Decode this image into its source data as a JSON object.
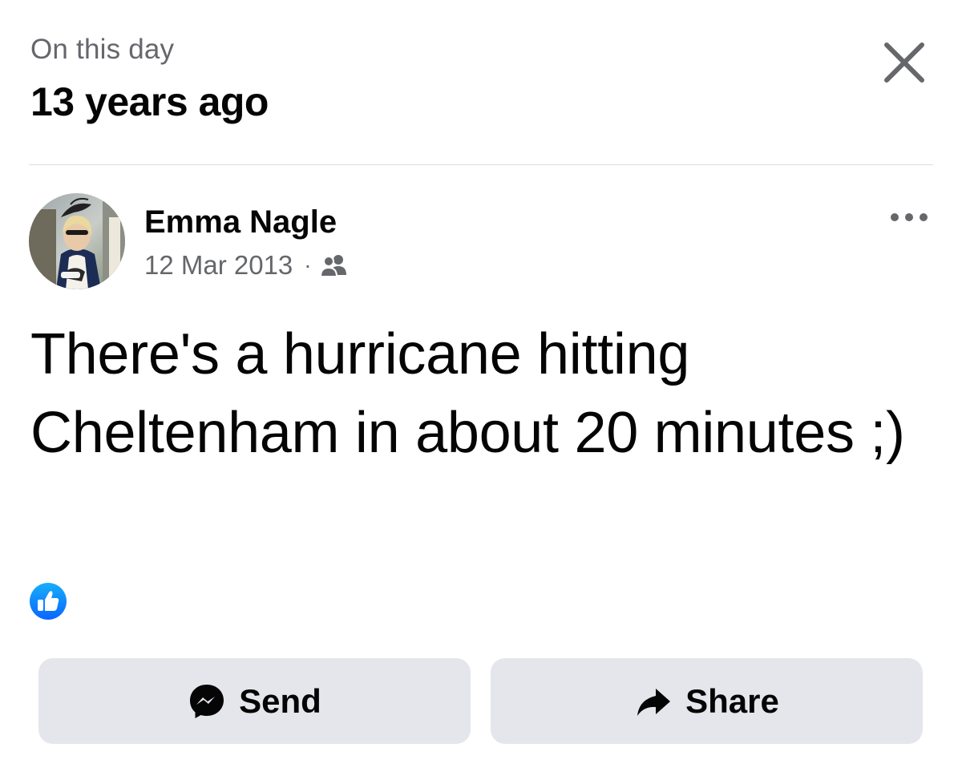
{
  "header": {
    "subtitle": "On this day",
    "title": "13 years ago"
  },
  "post": {
    "author": "Emma Nagle",
    "date": "12 Mar 2013",
    "separator": "·",
    "audience_icon": "friends-icon",
    "text": "There's a hurricane hitting Cheltenham in about 20 minutes ;)",
    "reaction_icon": "like-icon"
  },
  "actions": {
    "send_label": "Send",
    "share_label": "Share"
  },
  "colors": {
    "primary_text": "#050505",
    "secondary_text": "#65676b",
    "button_bg": "#e4e6eb",
    "like_blue": "#1877f2"
  }
}
